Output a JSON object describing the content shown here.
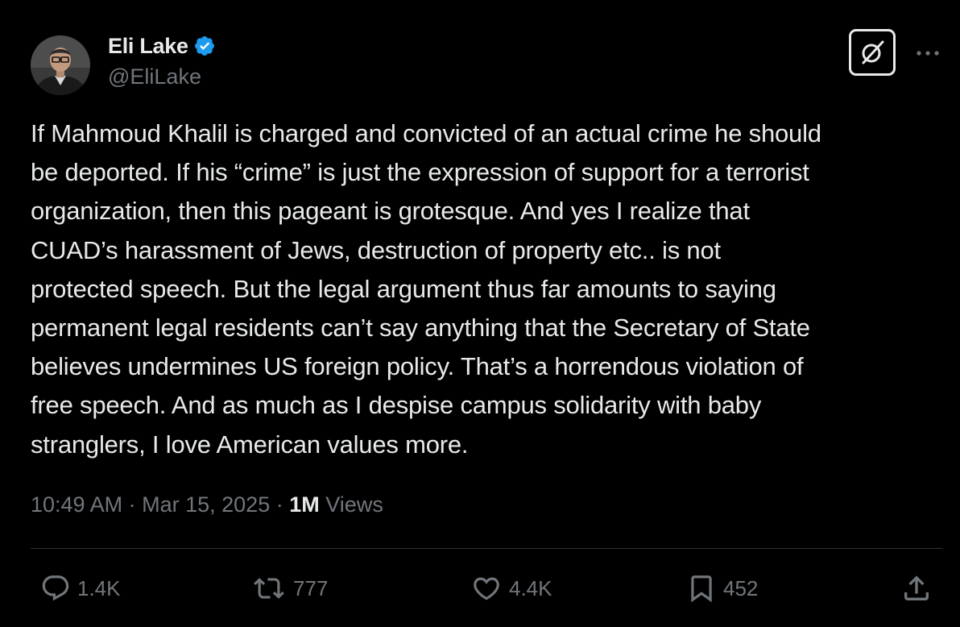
{
  "author": {
    "display_name": "Eli Lake",
    "handle": "@EliLake",
    "verified": true
  },
  "tweet": {
    "lines": [
      "If Mahmoud Khalil is charged and convicted of an actual crime he should",
      "be deported. If his “crime” is just the expression of support for a terrorist",
      "organization, then this pageant is grotesque.  And yes I realize that",
      "CUAD’s harassment of Jews, destruction of property etc.. is not",
      "protected speech.  But the legal argument thus far amounts to saying",
      "permanent legal residents can’t say anything that the Secretary of State",
      "believes undermines US foreign policy. That’s a horrendous violation of",
      "free speech. And as much as I despise campus solidarity with baby",
      "stranglers, I love American values more."
    ]
  },
  "meta": {
    "time": "10:49 AM",
    "separator": "·",
    "date": "Mar 15, 2025",
    "views_count": "1M",
    "views_label": "Views"
  },
  "actions": {
    "replies": "1.4K",
    "reposts": "777",
    "likes": "4.4K",
    "bookmarks": "452"
  },
  "icons": {
    "verified": "verified-badge-icon",
    "grok": "grok-icon",
    "more": "more-dots-icon",
    "reply": "reply-icon",
    "repost": "repost-icon",
    "like": "heart-icon",
    "bookmark": "bookmark-icon",
    "share": "share-icon"
  },
  "colors": {
    "background": "#000000",
    "primary_text": "#e7e9ea",
    "secondary_text": "#71767b",
    "verified_blue": "#1d9bf0",
    "divider": "#2f3336"
  }
}
